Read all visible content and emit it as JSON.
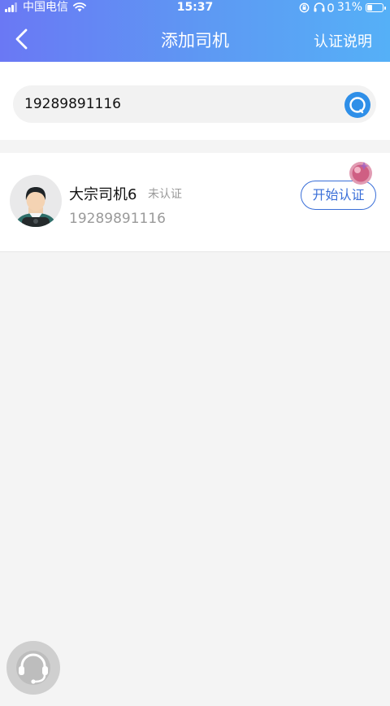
{
  "status_bar": {
    "carrier": "中国电信",
    "time": "15:37",
    "battery_percent": "31%",
    "battery_level": 0.31
  },
  "nav": {
    "title": "添加司机",
    "right_link": "认证说明",
    "back_icon": "chevron-left-icon"
  },
  "search": {
    "value": "19289891116",
    "icon": "search-icon"
  },
  "driver": {
    "name": "大宗司机6",
    "status": "未认证",
    "phone": "19289891116",
    "action_label": "开始认证"
  },
  "colors": {
    "header_start": "#6a78f4",
    "header_end": "#55b0f7",
    "accent": "#3a6fd8",
    "search_button": "#2f8fe8"
  }
}
